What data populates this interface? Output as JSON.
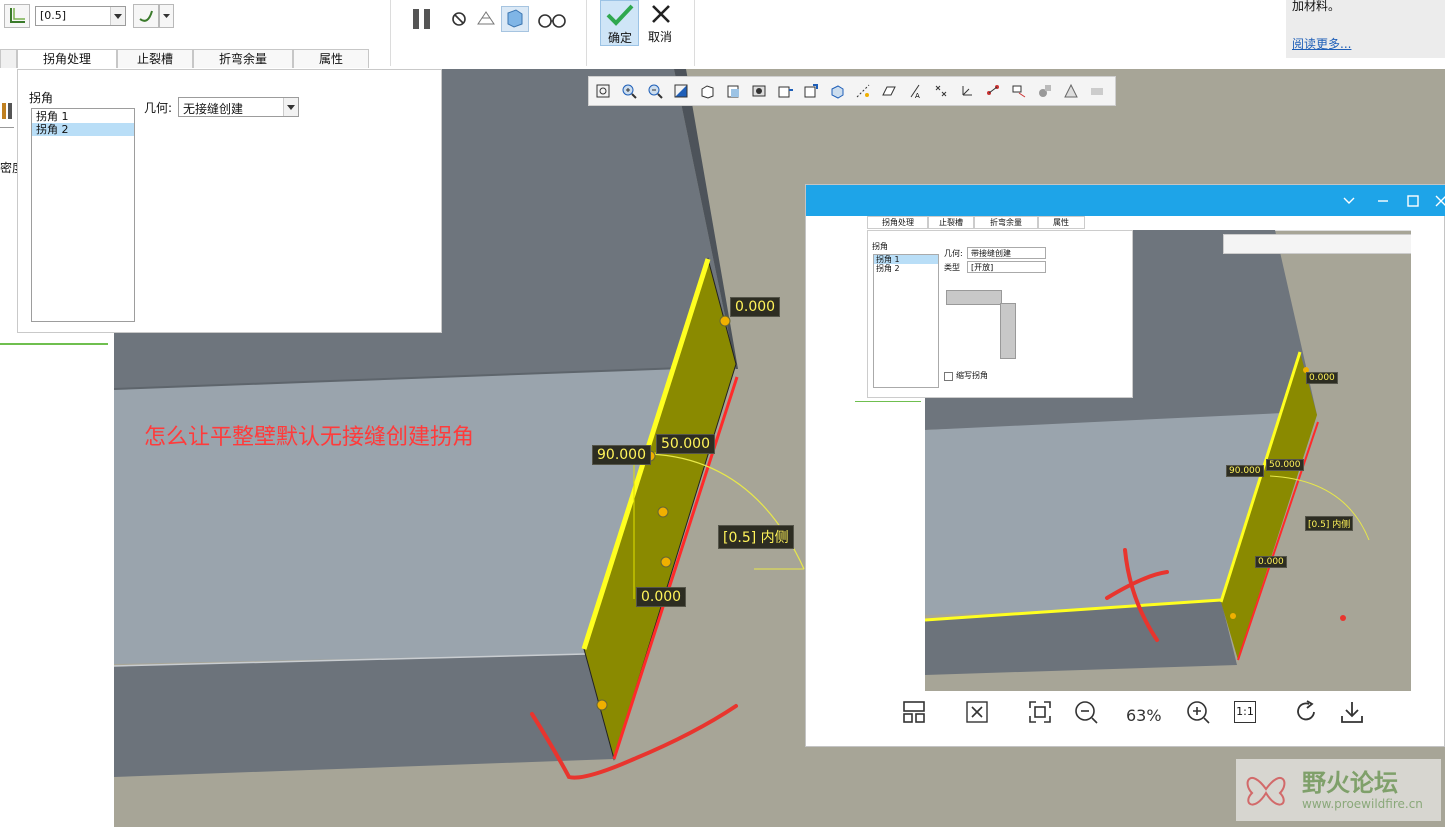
{
  "ribbon": {
    "thickness_value": "[0.5]",
    "confirm_label": "确定",
    "cancel_label": "取消",
    "help_text": "加材料。",
    "read_more": "阅读更多..."
  },
  "tabs": [
    "拐角处理",
    "止裂槽",
    "折弯余量",
    "属性"
  ],
  "left_strip": {
    "label": "密度"
  },
  "panel": {
    "section_title": "拐角",
    "corners": [
      "拐角 1",
      "拐角 2"
    ],
    "geometry_label": "几何:",
    "geometry_value": "无接缝创建"
  },
  "annotation": "怎么让平整壁默认无接缝创建拐角",
  "dimensions": {
    "d_top": "0.000",
    "d_length": "50.000",
    "d_angle": "90.000",
    "d_thickness": "[0.5] 内侧",
    "d_bottom": "0.000"
  },
  "viewer": {
    "tabs": [
      "拐角处理",
      "止裂槽",
      "折弯余量",
      "属性"
    ],
    "section_title": "拐角",
    "corners": [
      "拐角 1",
      "拐角 2"
    ],
    "geometry_label": "几何:",
    "geometry_value": "带接缝创建",
    "type_label": "类型",
    "type_value": "[开放]",
    "checkbox_label": "缩写拐角",
    "dims": {
      "d_top": "0.000",
      "d_length": "50.000",
      "d_angle": "90.000",
      "d_thickness": "[0.5] 内侧",
      "d_bottom": "0.000"
    },
    "zoom": "63%",
    "one_to_one": "1:1"
  },
  "watermark": {
    "title": "野火论坛",
    "url": "www.proewildfire.cn"
  },
  "colors": {
    "accent": "#1ea4e8",
    "confirm": "#2fa84f",
    "wall": "#8a8a00",
    "edge": "#ff2a2a",
    "annotation": "#ff3b3b"
  }
}
